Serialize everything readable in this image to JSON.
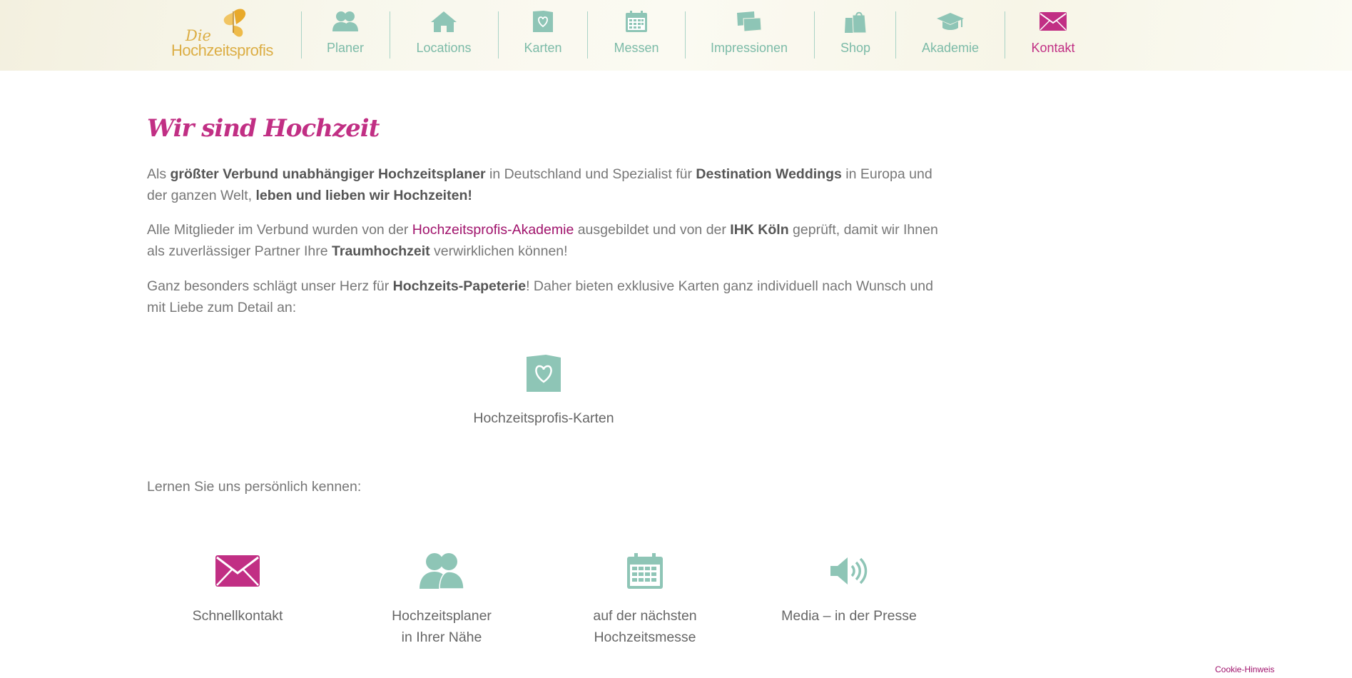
{
  "logo": {
    "line1": "Die",
    "line2": "Hochzeitsprofis"
  },
  "nav": [
    {
      "label": "Planer",
      "icon": "users-icon"
    },
    {
      "label": "Locations",
      "icon": "home-icon"
    },
    {
      "label": "Karten",
      "icon": "card-heart-icon"
    },
    {
      "label": "Messen",
      "icon": "calendar-icon"
    },
    {
      "label": "Impressionen",
      "icon": "photos-icon"
    },
    {
      "label": "Shop",
      "icon": "shopping-bags-icon"
    },
    {
      "label": "Akademie",
      "icon": "graduation-cap-icon"
    },
    {
      "label": "Kontakt",
      "icon": "envelope-icon",
      "active": true
    }
  ],
  "colors": {
    "accent": "#c12f84",
    "teal": "#8ec5b6",
    "gold": "#dcae45",
    "link": "#a0136c"
  },
  "main": {
    "title": "Wir sind Hochzeit",
    "p1": {
      "t1": "Als ",
      "b1": "größter Verbund unabhängiger Hochzeitsplaner",
      "t2": " in Deutschland und Spezialist für ",
      "b2": "Destination Weddings",
      "t3": " in Europa und der ganzen Welt, ",
      "b3": "leben und lieben wir Hochzeiten!"
    },
    "p2": {
      "t1": "Alle Mitglieder im Verbund wurden von der ",
      "link": "Hochzeitsprofis-Akademie",
      "t2": " ausgebildet und von der ",
      "b1": "IHK Köln",
      "t3": " geprüft, damit wir Ihnen als zuverlässiger Partner Ihre ",
      "b2": "Traumhochzeit",
      "t4": " verwirklichen können!"
    },
    "p3": {
      "t1": "Ganz besonders schlägt unser Herz für ",
      "b1": "Hochzeits-Papeterie",
      "t2": "! Daher bieten exklusive Karten ganz individuell nach Wunsch und mit Liebe zum Detail an:"
    },
    "card_link": {
      "label": "Hochzeitsprofis-Karten",
      "icon": "card-heart-icon"
    },
    "intro": "Lernen Sie uns persönlich kennen:",
    "features": [
      {
        "label": "Schnellkontakt",
        "icon": "envelope-icon"
      },
      {
        "label": "Hochzeitsplaner\nin Ihrer Nähe",
        "icon": "users-icon"
      },
      {
        "label": "auf der nächsten\nHochzeitsmesse",
        "icon": "calendar-icon"
      },
      {
        "label": "Media – in der Presse",
        "icon": "speaker-icon"
      }
    ]
  },
  "footer": {
    "cookie": "Cookie-Hinweis"
  }
}
